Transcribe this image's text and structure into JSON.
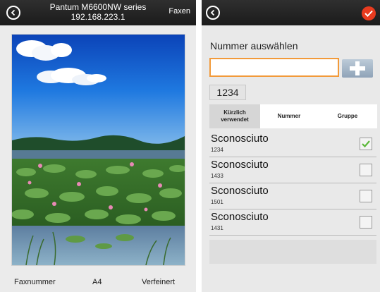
{
  "left_screen": {
    "header": {
      "printer_name": "Pantum M6600NW series",
      "ip_address": "192.168.223.1",
      "send_label": "Faxen"
    },
    "preview_icon": "landscape-photo",
    "bottom_bar": {
      "fax_number_label": "Faxnummer",
      "paper_size": "A4",
      "resolution": "Verfeinert"
    }
  },
  "right_screen": {
    "select_label": "Nummer auswählen",
    "number_input": {
      "value": "",
      "placeholder": ""
    },
    "add_icon": "plus-icon",
    "recent_chip": "1234",
    "tabs": [
      {
        "label_line1": "Kürzlich",
        "label_line2": "verwendet",
        "active": true
      },
      {
        "label_line1": "Nummer",
        "label_line2": "",
        "active": false
      },
      {
        "label_line1": "Gruppe",
        "label_line2": "",
        "active": false
      }
    ],
    "contacts": [
      {
        "name": "Sconosciuto",
        "number": "1234",
        "checked": true
      },
      {
        "name": "Sconosciuto",
        "number": "1433",
        "checked": false
      },
      {
        "name": "Sconosciuto",
        "number": "1501",
        "checked": false
      },
      {
        "name": "Sconosciuto",
        "number": "1431",
        "checked": false
      }
    ],
    "colors": {
      "accent_orange": "#f29a3a",
      "ok_red": "#e83b1f",
      "check_green": "#5cb83a",
      "topbar": "#222222"
    }
  }
}
